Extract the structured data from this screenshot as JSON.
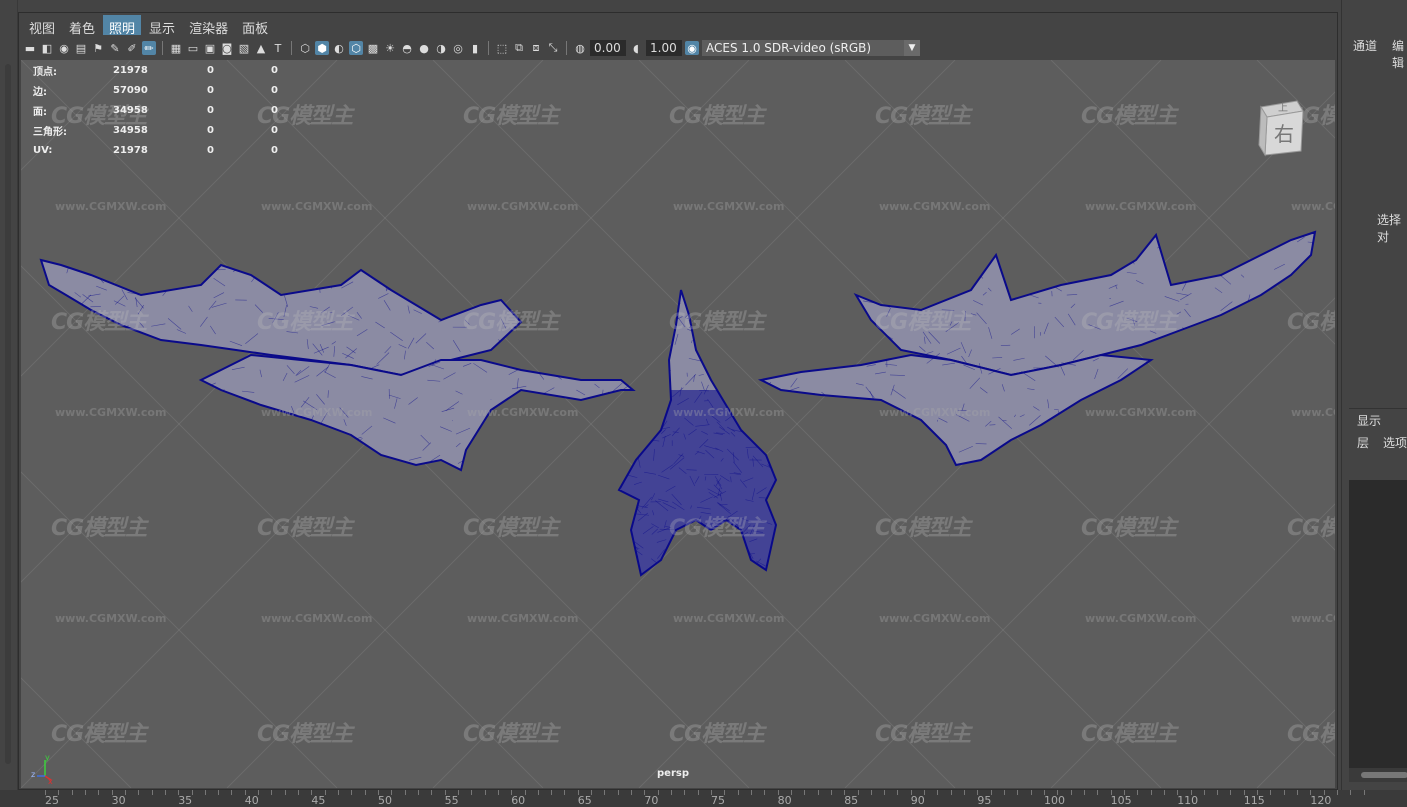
{
  "menu": {
    "items": [
      {
        "label": "视图"
      },
      {
        "label": "着色"
      },
      {
        "label": "照明",
        "active": true
      },
      {
        "label": "显示"
      },
      {
        "label": "渲染器"
      },
      {
        "label": "面板"
      }
    ]
  },
  "toolbar": {
    "gamma_value": "0.00",
    "exposure_value": "1.00",
    "color_space": "ACES 1.0 SDR-video (sRGB)"
  },
  "hud": {
    "rows": [
      {
        "label": "顶点:",
        "v1": "21978",
        "v2": "0",
        "v3": "0"
      },
      {
        "label": "边:",
        "v1": "57090",
        "v2": "0",
        "v3": "0"
      },
      {
        "label": "面:",
        "v1": "34958",
        "v2": "0",
        "v3": "0"
      },
      {
        "label": "三角形:",
        "v1": "34958",
        "v2": "0",
        "v3": "0"
      },
      {
        "label": "UV:",
        "v1": "21978",
        "v2": "0",
        "v3": "0"
      }
    ]
  },
  "viewport": {
    "camera": "persp",
    "viewcube_top": "上",
    "viewcube_face": "右",
    "axis_y": "y",
    "axis_z": "z",
    "axis_x": "x",
    "wireframe_color": "#0a0a8a",
    "background_color": "#5d5d5d"
  },
  "watermark": {
    "logo": "CG模型主",
    "url": "www.CGMXW.com"
  },
  "right_panel": {
    "tab_channels": "通道",
    "tab_edit": "编辑",
    "select_label": "选择对",
    "display_tab": "显示",
    "layer_label": "层",
    "options_label": "选项"
  },
  "timeline": {
    "ticks": [
      "25",
      "30",
      "35",
      "40",
      "45",
      "50",
      "55",
      "60",
      "65",
      "70",
      "75",
      "80",
      "85",
      "90",
      "95",
      "100",
      "105",
      "110",
      "115",
      "120"
    ]
  }
}
